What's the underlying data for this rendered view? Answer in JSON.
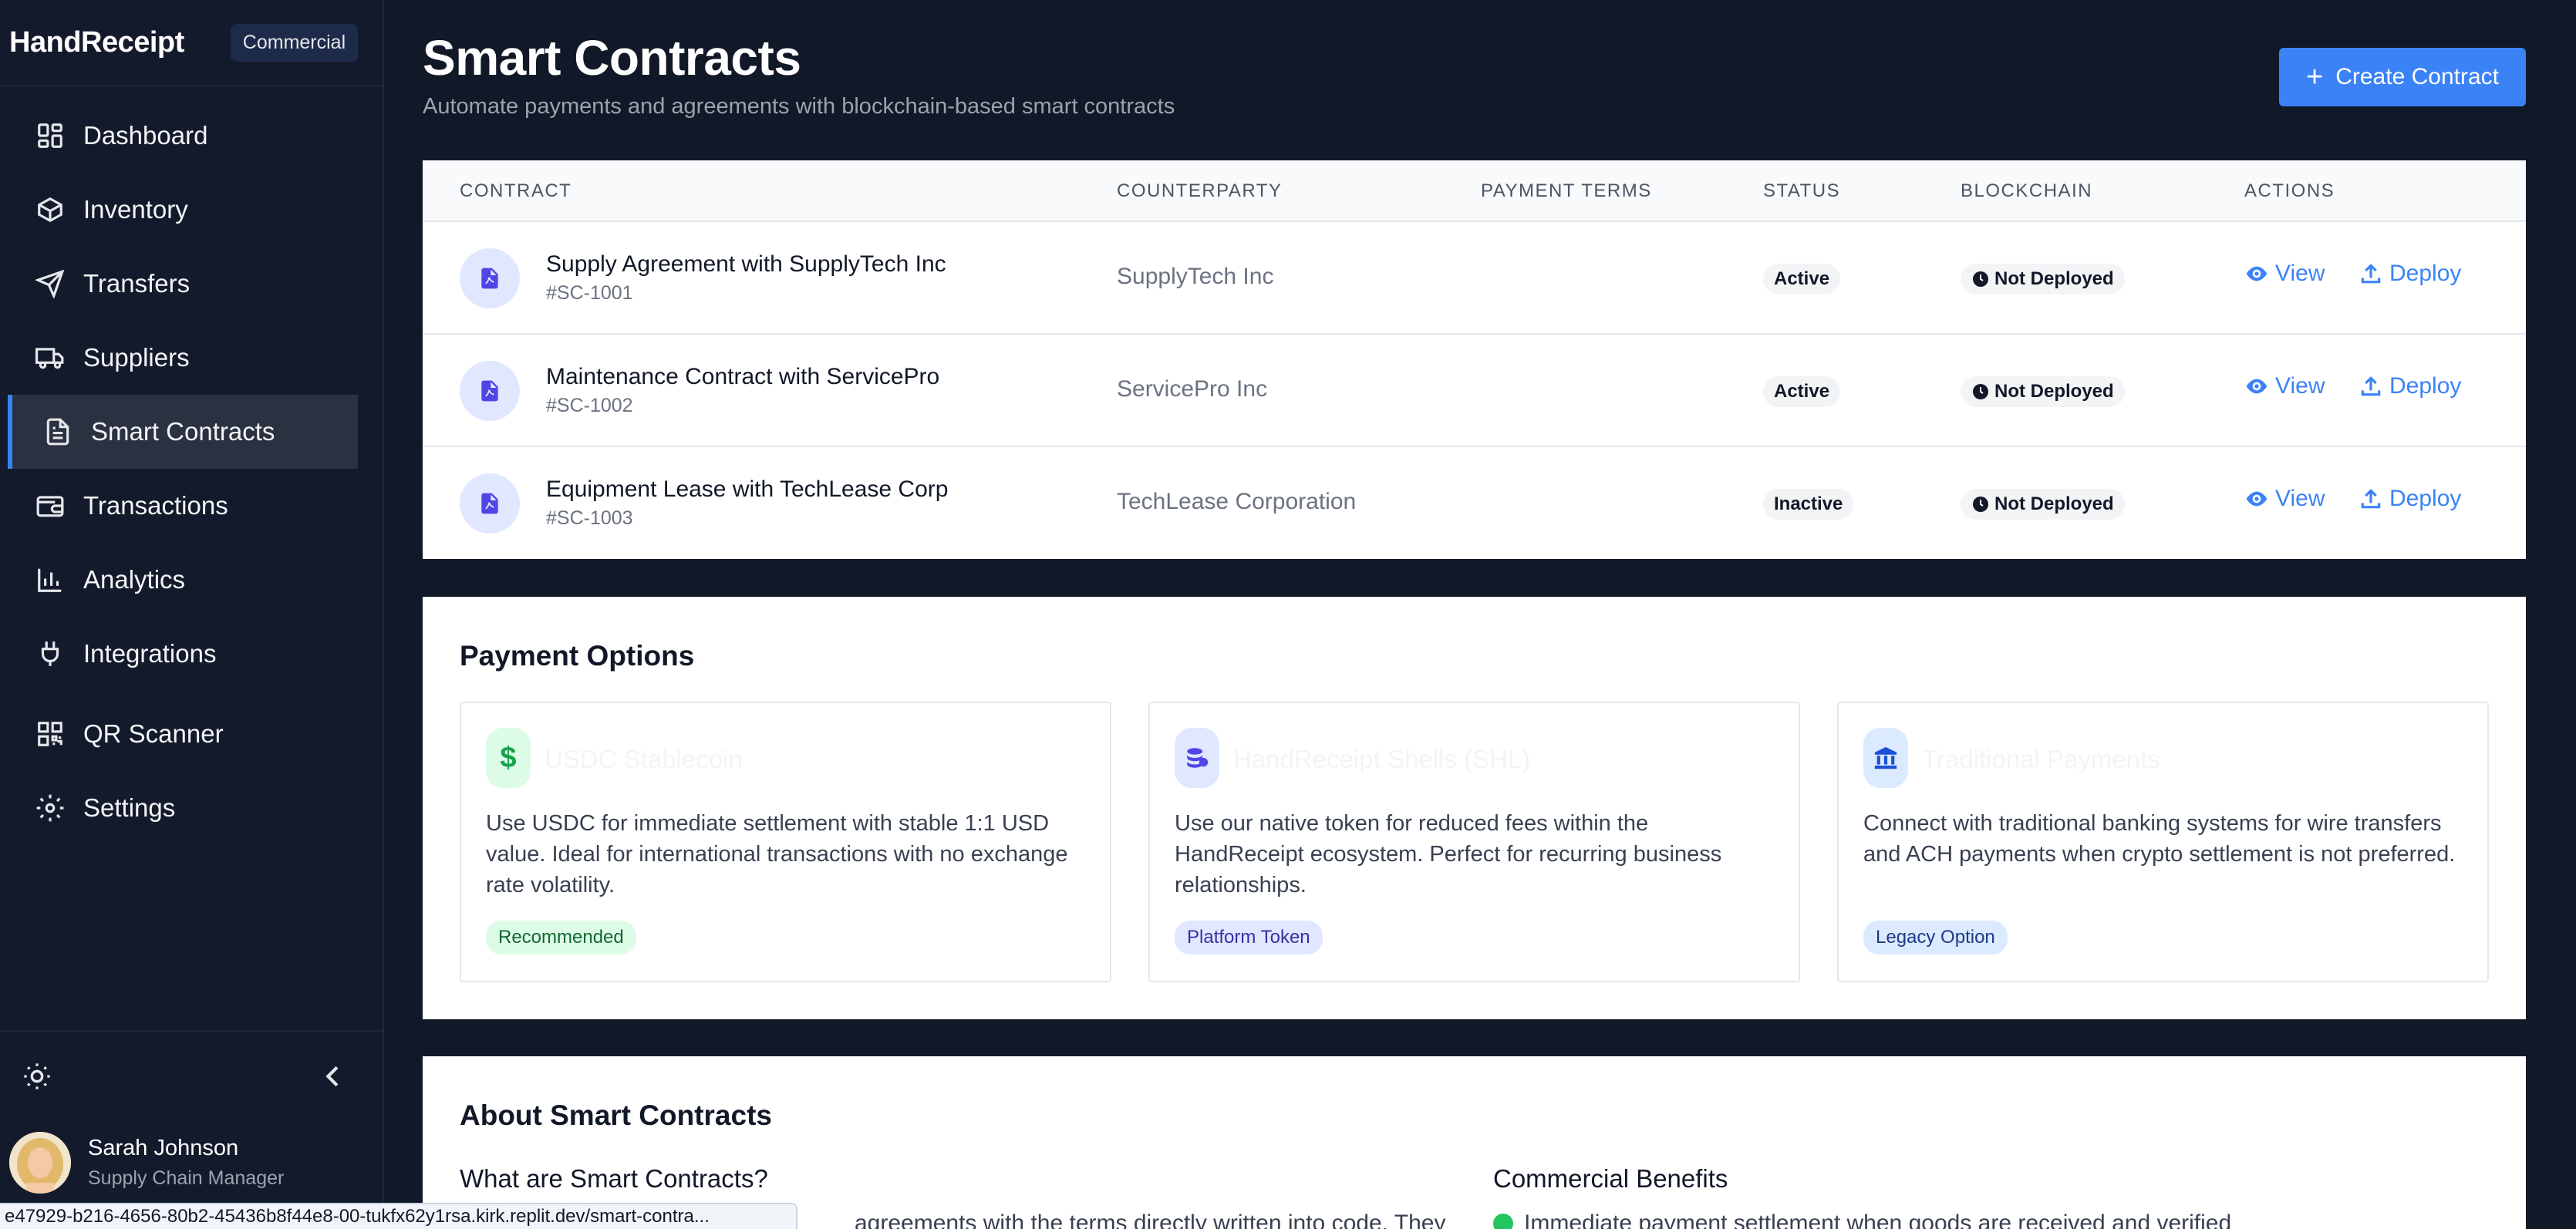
{
  "app": {
    "name": "HandReceipt",
    "badge": "Commercial"
  },
  "sidebar": {
    "items": [
      {
        "label": "Dashboard",
        "icon": "dashboard-icon",
        "active": false
      },
      {
        "label": "Inventory",
        "icon": "box-icon",
        "active": false
      },
      {
        "label": "Transfers",
        "icon": "send-icon",
        "active": false
      },
      {
        "label": "Suppliers",
        "icon": "truck-icon",
        "active": false
      },
      {
        "label": "Smart Contracts",
        "icon": "document-icon",
        "active": true
      },
      {
        "label": "Transactions",
        "icon": "wallet-icon",
        "active": false
      },
      {
        "label": "Analytics",
        "icon": "bar-chart-icon",
        "active": false
      },
      {
        "label": "Integrations",
        "icon": "plug-icon",
        "active": false
      },
      {
        "label": "QR Scanner",
        "icon": "qr-code-icon",
        "active": false
      },
      {
        "label": "Settings",
        "icon": "gear-icon",
        "active": false
      }
    ],
    "user": {
      "name": "Sarah Johnson",
      "role": "Supply Chain Manager"
    }
  },
  "header": {
    "title": "Smart Contracts",
    "subtitle": "Automate payments and agreements with blockchain-based smart contracts",
    "create_label": "Create Contract"
  },
  "table": {
    "columns": [
      "CONTRACT",
      "COUNTERPARTY",
      "PAYMENT TERMS",
      "STATUS",
      "BLOCKCHAIN",
      "ACTIONS"
    ],
    "rows": [
      {
        "name": "Supply Agreement with SupplyTech Inc",
        "id": "#SC-1001",
        "counterparty": "SupplyTech Inc",
        "payment_terms": "",
        "status": "Active",
        "blockchain": "Not Deployed",
        "view": "View",
        "deploy": "Deploy"
      },
      {
        "name": "Maintenance Contract with ServicePro",
        "id": "#SC-1002",
        "counterparty": "ServicePro Inc",
        "payment_terms": "",
        "status": "Active",
        "blockchain": "Not Deployed",
        "view": "View",
        "deploy": "Deploy"
      },
      {
        "name": "Equipment Lease with TechLease Corp",
        "id": "#SC-1003",
        "counterparty": "TechLease Corporation",
        "payment_terms": "",
        "status": "Inactive",
        "blockchain": "Not Deployed",
        "view": "View",
        "deploy": "Deploy"
      }
    ]
  },
  "payment": {
    "title": "Payment Options",
    "options": [
      {
        "icon": "dollar-icon",
        "title": "USDC Stablecoin",
        "description": "Use USDC for immediate settlement with stable 1:1 USD value. Ideal for international transactions with no exchange rate volatility.",
        "tag": "Recommended",
        "accent": "#16a34a"
      },
      {
        "icon": "coins-icon",
        "title": "HandReceipt Shells (SHL)",
        "description": "Use our native token for reduced fees within the HandReceipt ecosystem. Perfect for recurring business relationships.",
        "tag": "Platform Token",
        "accent": "#4f46e5"
      },
      {
        "icon": "bank-icon",
        "title": "Traditional Payments",
        "description": "Connect with traditional banking systems for wire transfers and ACH payments when crypto settlement is not preferred.",
        "tag": "Legacy Option",
        "accent": "#1d4ed8"
      }
    ]
  },
  "about": {
    "title": "About Smart Contracts",
    "left_heading": "What are Smart Contracts?",
    "left_text": "agreements with the terms directly written into code. They",
    "right_heading": "Commercial Benefits",
    "right_text": "Immediate payment settlement when goods are received and verified"
  },
  "status_url": "e47929-b216-4656-80b2-45436b8f44e8-00-tukfx62y1rsa.kirk.replit.dev/smart-contra...",
  "colors": {
    "accent": "#3b82f6",
    "sidebar_bg": "#131a2b",
    "page_bg": "#111827"
  }
}
